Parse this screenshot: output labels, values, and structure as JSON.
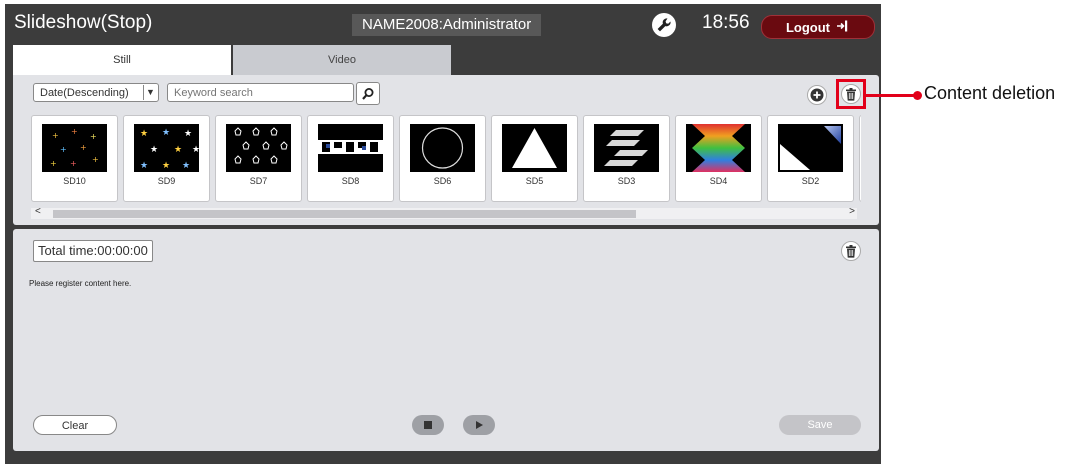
{
  "app": {
    "title": "Slideshow(Stop)",
    "user_label": "NAME2008:Administrator",
    "time": "18:56",
    "logout_label": "Logout"
  },
  "tabs": [
    {
      "label": "Still",
      "active": true
    },
    {
      "label": "Video",
      "active": false
    }
  ],
  "toolbar": {
    "sort_value": "Date(Descending)",
    "search_placeholder": "Keyword search"
  },
  "thumbnails": [
    {
      "label": "SD10"
    },
    {
      "label": "SD9"
    },
    {
      "label": "SD7"
    },
    {
      "label": "SD8"
    },
    {
      "label": "SD6"
    },
    {
      "label": "SD5"
    },
    {
      "label": "SD3"
    },
    {
      "label": "SD4"
    },
    {
      "label": "SD2"
    }
  ],
  "playlist": {
    "total_time": "Total time:00:00:00",
    "empty_message": "Please register content here.",
    "clear_label": "Clear",
    "save_label": "Save"
  },
  "callout": {
    "label": "Content deletion",
    "color": "#e2001a"
  },
  "colors": {
    "frame": "#3c3c3c",
    "panel": "#e2e3e7",
    "logout": "#6a0a10"
  }
}
